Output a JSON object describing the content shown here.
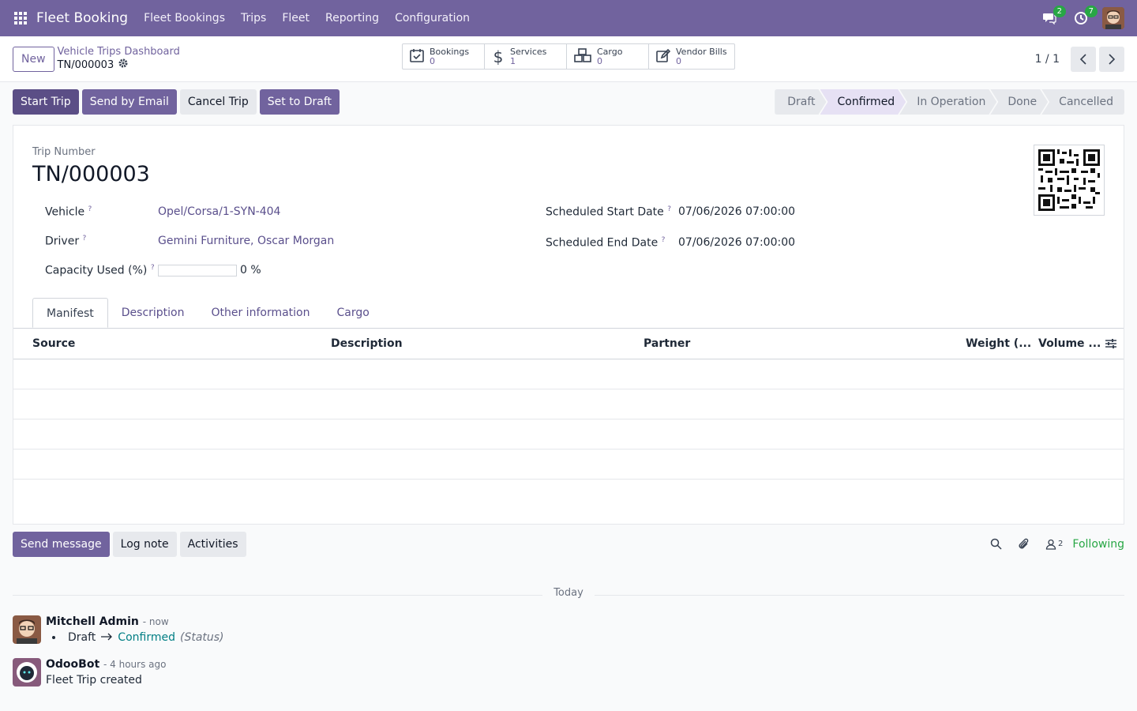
{
  "navbar": {
    "brand": "Fleet Booking",
    "menu": [
      "Fleet Bookings",
      "Trips",
      "Fleet",
      "Reporting",
      "Configuration"
    ],
    "messages_badge": "2",
    "activities_badge": "7"
  },
  "control": {
    "new_label": "New",
    "breadcrumb_parent": "Vehicle Trips Dashboard",
    "breadcrumb_current": "TN/000003",
    "smart_buttons": [
      {
        "label": "Bookings",
        "value": "0",
        "icon": "calendar-check-icon"
      },
      {
        "label": "Services",
        "value": "1",
        "icon": "dollar-icon"
      },
      {
        "label": "Cargo",
        "value": "0",
        "icon": "cubes-icon"
      },
      {
        "label": "Vendor Bills",
        "value": "0",
        "icon": "edit-icon"
      }
    ],
    "pager": "1 / 1"
  },
  "actions": {
    "start_trip": "Start Trip",
    "send_email": "Send by Email",
    "cancel_trip": "Cancel Trip",
    "set_draft": "Set to Draft"
  },
  "stages": [
    {
      "label": "Draft",
      "active": false
    },
    {
      "label": "Confirmed",
      "active": true
    },
    {
      "label": "In Operation",
      "active": false
    },
    {
      "label": "Done",
      "active": false
    },
    {
      "label": "Cancelled",
      "active": false
    }
  ],
  "form": {
    "trip_number_label": "Trip Number",
    "trip_number": "TN/000003",
    "vehicle_label": "Vehicle",
    "vehicle": "Opel/Corsa/1-SYN-404",
    "driver_label": "Driver",
    "driver": "Gemini Furniture, Oscar Morgan",
    "capacity_label": "Capacity Used (%)",
    "capacity_value": 0,
    "capacity_text": "0 %",
    "start_label": "Scheduled Start Date",
    "start": "07/06/2026 07:00:00",
    "end_label": "Scheduled End Date",
    "end": "07/06/2026 07:00:00",
    "help_mark": "?"
  },
  "tabs": [
    "Manifest",
    "Description",
    "Other information",
    "Cargo"
  ],
  "manifest": {
    "columns": [
      "Source",
      "Description",
      "Partner",
      "Weight (...",
      "Volume ..."
    ]
  },
  "chatter": {
    "send_message": "Send message",
    "log_note": "Log note",
    "activities": "Activities",
    "followers_count": "2",
    "following": "Following",
    "today": "Today",
    "messages": [
      {
        "author": "Mitchell Admin",
        "time": "- now",
        "old": "Draft",
        "new": "Confirmed",
        "field": "(Status)"
      },
      {
        "author": "OdooBot",
        "time": "- 4 hours ago",
        "body": "Fleet Trip created"
      }
    ]
  }
}
